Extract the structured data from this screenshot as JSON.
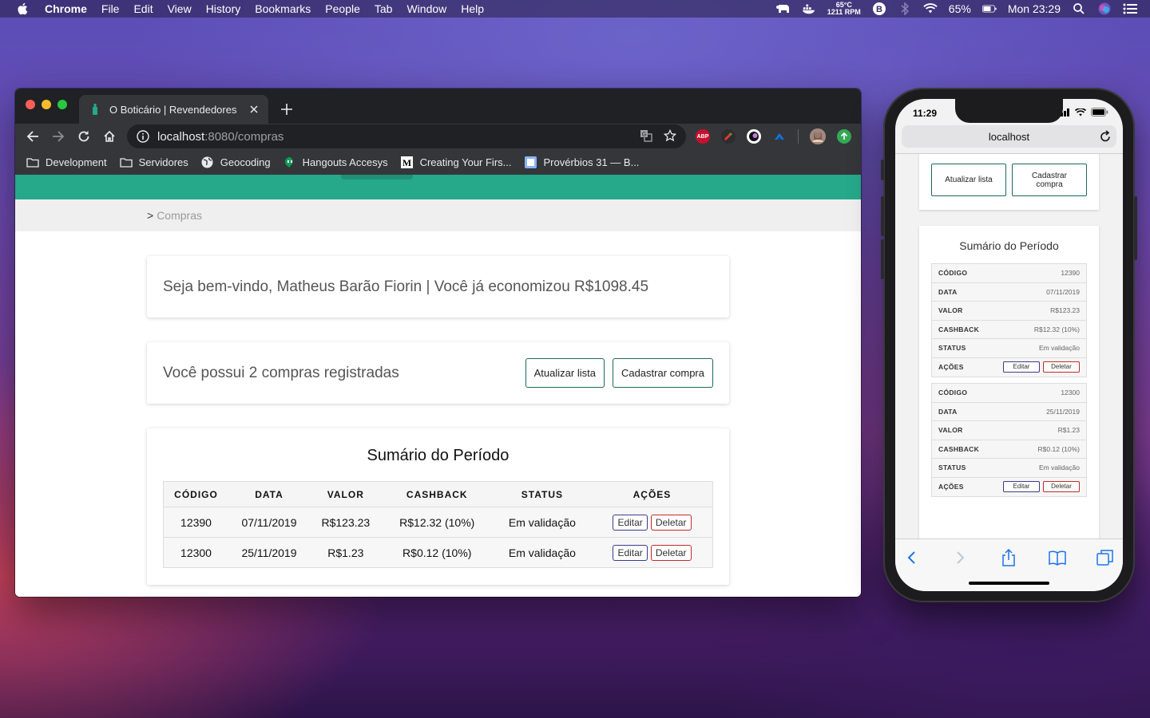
{
  "menubar": {
    "app": "Chrome",
    "items": [
      "File",
      "Edit",
      "View",
      "History",
      "Bookmarks",
      "People",
      "Tab",
      "Window",
      "Help"
    ],
    "temperature": "65°C",
    "rpm": "1211 RPM",
    "battery": "65%",
    "clock": "Mon 23:29"
  },
  "browser": {
    "tab_title": "O Boticário | Revendedores",
    "url_host": "localhost",
    "url_path": ":8080/compras",
    "bookmarks": [
      "Development",
      "Servidores",
      "Geocoding",
      "Hangouts Accesys",
      "Creating Your Firs...",
      "Provérbios 31 — B..."
    ]
  },
  "page": {
    "breadcrumb_sep": ">",
    "breadcrumb": "Compras",
    "welcome": "Seja bem-vindo, Matheus Barão Fiorin | Você já economizou R$1098.45",
    "purchases_text": "Você possui 2 compras registradas",
    "refresh_button": "Atualizar lista",
    "add_button": "Cadastrar compra",
    "summary_title": "Sumário do Período",
    "columns": [
      "CÓDIGO",
      "DATA",
      "VALOR",
      "CASHBACK",
      "STATUS",
      "AÇÕES"
    ],
    "rows": [
      {
        "codigo": "12390",
        "data": "07/11/2019",
        "valor": "R$123.23",
        "cashback": "R$12.32 (10%)",
        "status": "Em validação"
      },
      {
        "codigo": "12300",
        "data": "25/11/2019",
        "valor": "R$1.23",
        "cashback": "R$0.12 (10%)",
        "status": "Em validação"
      }
    ],
    "edit_label": "Editar",
    "delete_label": "Deletar"
  },
  "phone": {
    "time": "11:29",
    "address": "localhost",
    "refresh_button": "Atualizar lista",
    "add_button": "Cadastrar compra",
    "summary_title": "Sumário do Período",
    "labels": [
      "CÓDIGO",
      "DATA",
      "VALOR",
      "CASHBACK",
      "STATUS",
      "AÇÕES"
    ],
    "edit_label": "Editar",
    "delete_label": "Deletar"
  },
  "colors": {
    "brand_green": "#26a88a",
    "edit_border": "#3b3b8a",
    "delete_border": "#c22a2a"
  }
}
